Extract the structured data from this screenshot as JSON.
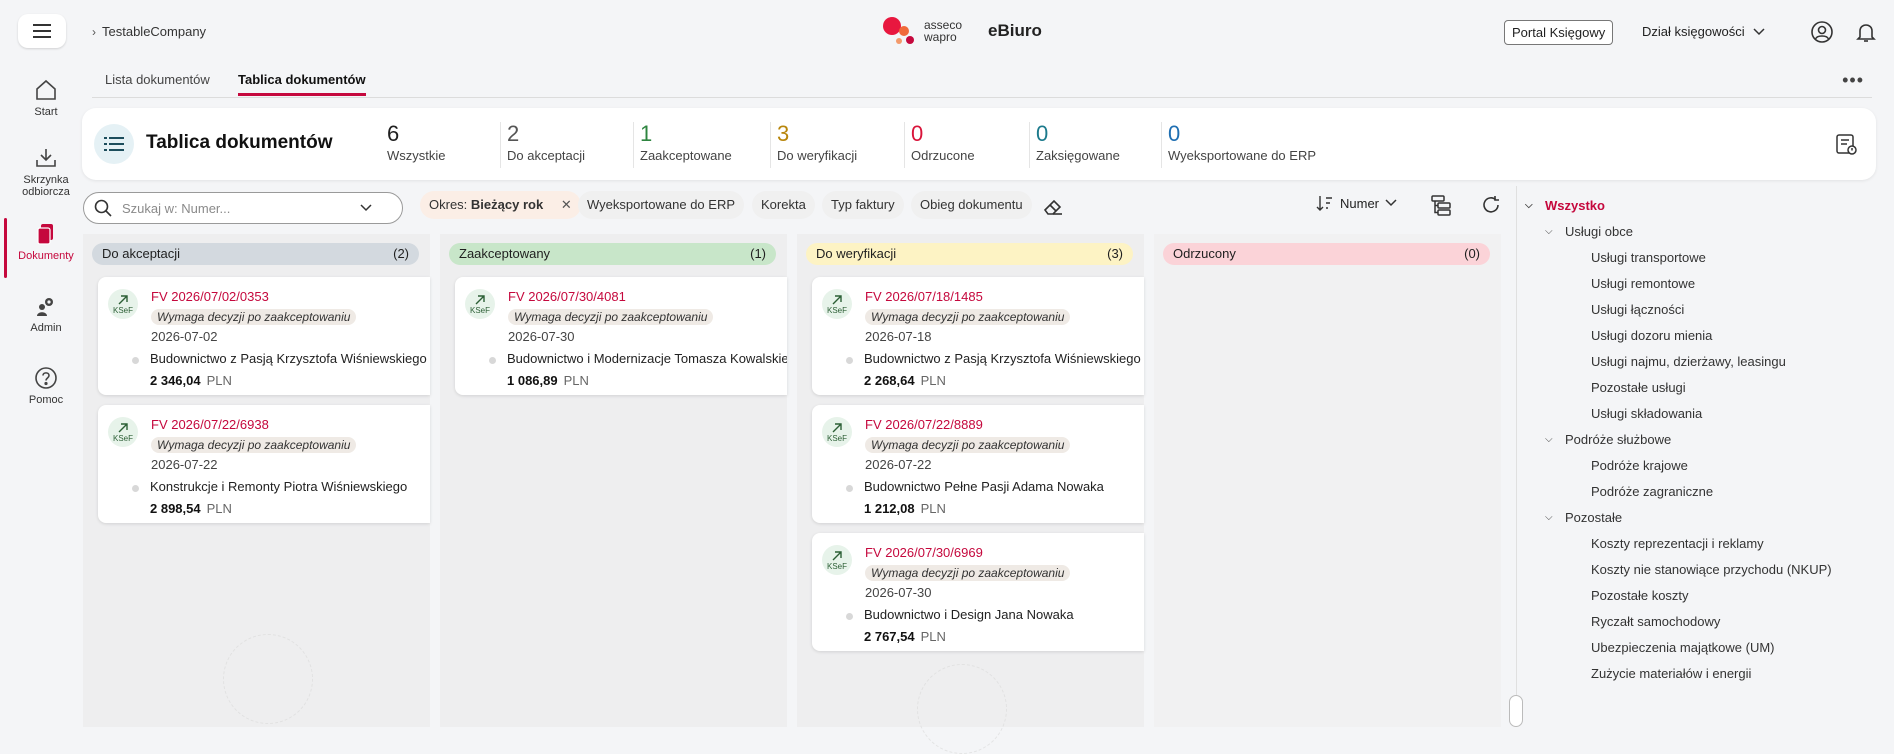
{
  "nav": {
    "items": [
      {
        "label": "Start",
        "icon": "home-icon"
      },
      {
        "label": "Skrzynka odbiorcza",
        "icon": "inbox-icon"
      },
      {
        "label": "Dokumenty",
        "icon": "documents-icon"
      },
      {
        "label": "Admin",
        "icon": "admin-gear-icon"
      },
      {
        "label": "Pomoc",
        "icon": "help-icon"
      }
    ]
  },
  "header": {
    "company": "TestableCompany",
    "brand_line1": "asseco",
    "brand_line2": "wapro",
    "app_name": "eBiuro",
    "portal_button": "Portal Księgowy",
    "department": "Dział księgowości"
  },
  "tabs": [
    {
      "label": "Lista dokumentów"
    },
    {
      "label": "Tablica dokumentów"
    }
  ],
  "summary": {
    "title": "Tablica dokumentów",
    "stats": [
      {
        "num": "6",
        "label": "Wszystkie",
        "color": "#1f1f1f"
      },
      {
        "num": "2",
        "label": "Do akceptacji",
        "color": "#555555"
      },
      {
        "num": "1",
        "label": "Zaakceptowane",
        "color": "#2e8540"
      },
      {
        "num": "3",
        "label": "Do weryfikacji",
        "color": "#b8860b"
      },
      {
        "num": "0",
        "label": "Odrzucone",
        "color": "#d9143a"
      },
      {
        "num": "0",
        "label": "Zaksięgowane",
        "color": "#1c7a8c"
      },
      {
        "num": "0",
        "label": "Wyeksportowane do ERP",
        "color": "#1f6fb2"
      }
    ]
  },
  "filters": {
    "search_placeholder": "Szukaj w: Numer...",
    "period_label": "Okres:",
    "period_value": "Bieżący rok",
    "chips": [
      "Wyeksportowane do ERP",
      "Korekta",
      "Typ faktury",
      "Obieg dokumentu"
    ],
    "sort_label": "Numer"
  },
  "board": {
    "columns": [
      {
        "title": "Do akceptacji",
        "count": "(2)",
        "color": "#d3d9df",
        "cards": [
          {
            "number": "FV 2026/07/02/0353",
            "status": "Wymaga decyzji po zaakceptowaniu",
            "date": "2026-07-02",
            "party": "Budownictwo z Pasją Krzysztofa Wiśniewskiego",
            "amount": "2 346,04",
            "currency": "PLN"
          },
          {
            "number": "FV 2026/07/22/6938",
            "status": "Wymaga decyzji po zaakceptowaniu",
            "date": "2026-07-22",
            "party": "Konstrukcje i Remonty Piotra Wiśniewskiego",
            "amount": "2 898,54",
            "currency": "PLN"
          }
        ]
      },
      {
        "title": "Zaakceptowany",
        "count": "(1)",
        "color": "#c8e6c9",
        "cards": [
          {
            "number": "FV 2026/07/30/4081",
            "status": "Wymaga decyzji po zaakceptowaniu",
            "date": "2026-07-30",
            "party": "Budownictwo i Modernizacje Tomasza Kowalskiego",
            "amount": "1 086,89",
            "currency": "PLN"
          }
        ]
      },
      {
        "title": "Do weryfikacji",
        "count": "(3)",
        "color": "#fdf3c4",
        "cards": [
          {
            "number": "FV 2026/07/18/1485",
            "status": "Wymaga decyzji po zaakceptowaniu",
            "date": "2026-07-18",
            "party": "Budownictwo z Pasją Krzysztofa Wiśniewskiego",
            "amount": "2 268,64",
            "currency": "PLN"
          },
          {
            "number": "FV 2026/07/22/8889",
            "status": "Wymaga decyzji po zaakceptowaniu",
            "date": "2026-07-22",
            "party": "Budownictwo Pełne Pasji Adama Nowaka",
            "amount": "1 212,08",
            "currency": "PLN"
          },
          {
            "number": "FV 2026/07/30/6969",
            "status": "Wymaga decyzji po zaakceptowaniu",
            "date": "2026-07-30",
            "party": "Budownictwo i Design Jana Nowaka",
            "amount": "2 767,54",
            "currency": "PLN"
          }
        ]
      },
      {
        "title": "Odrzucony",
        "count": "(0)",
        "color": "#fbd3d8",
        "cards": []
      }
    ],
    "ksef_label": "KSeF"
  },
  "tree": {
    "root": "Wszystko",
    "groups": [
      {
        "label": "Usługi obce",
        "items": [
          "Usługi transportowe",
          "Usługi remontowe",
          "Usługi łączności",
          "Usługi dozoru mienia",
          "Usługi najmu, dzierżawy, leasingu",
          "Pozostałe usługi",
          "Usługi składowania"
        ]
      },
      {
        "label": "Podróże służbowe",
        "items": [
          "Podróże krajowe",
          "Podróże zagraniczne"
        ]
      },
      {
        "label": "Pozostałe",
        "items": [
          "Koszty reprezentacji i reklamy",
          "Koszty nie stanowiące przychodu (NKUP)",
          "Pozostałe koszty",
          "Ryczałt samochodowy",
          "Ubezpieczenia majątkowe (UM)",
          "Zużycie materiałów i energii"
        ]
      }
    ]
  },
  "colors": {
    "accent": "#c5083d"
  }
}
